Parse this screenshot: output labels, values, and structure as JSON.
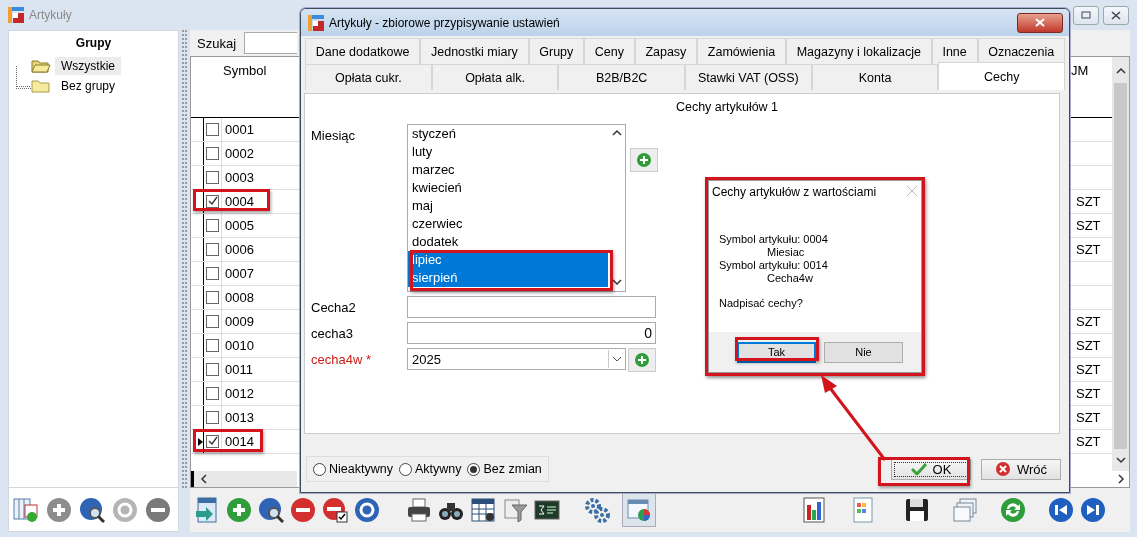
{
  "app_window": {
    "title": "Artykuły"
  },
  "groups_panel": {
    "title": "Grupy",
    "tree": [
      {
        "label": "Wszystkie",
        "selected": true
      },
      {
        "label": "Bez grupy",
        "selected": false
      }
    ]
  },
  "search": {
    "label": "Szukaj"
  },
  "grid": {
    "columns": [
      "Symbol",
      "JM"
    ],
    "rows": [
      {
        "symbol": "0001",
        "checked": false,
        "current": false
      },
      {
        "symbol": "0002",
        "checked": false,
        "current": false
      },
      {
        "symbol": "0003",
        "checked": false,
        "current": false
      },
      {
        "symbol": "0004",
        "unit": "SZT",
        "checked": true,
        "current": false
      },
      {
        "symbol": "0005",
        "unit": "SZT",
        "checked": false,
        "current": false
      },
      {
        "symbol": "0006",
        "unit": "SZT",
        "checked": false,
        "current": false
      },
      {
        "symbol": "0007",
        "checked": false,
        "current": false
      },
      {
        "symbol": "0008",
        "checked": false,
        "current": false
      },
      {
        "symbol": "0009",
        "unit": "SZT",
        "checked": false,
        "current": false
      },
      {
        "symbol": "0010",
        "unit": "SZT",
        "checked": false,
        "current": false
      },
      {
        "symbol": "0011",
        "unit": "SZT",
        "checked": false,
        "current": false
      },
      {
        "symbol": "0012",
        "unit": "SZT",
        "checked": false,
        "current": false
      },
      {
        "symbol": "0013",
        "unit": "SZT",
        "checked": false,
        "current": false
      },
      {
        "symbol": "0014",
        "unit": "SZT",
        "checked": true,
        "current": true
      }
    ]
  },
  "dialog": {
    "title": "Artykuły - zbiorowe przypisywanie ustawień",
    "tab_rows": [
      [
        {
          "label": "Dane dodatkowe",
          "selected": false
        },
        {
          "label": "Jednostki miary",
          "selected": false
        },
        {
          "label": "Grupy",
          "selected": false
        },
        {
          "label": "Ceny",
          "selected": false
        },
        {
          "label": "Zapasy",
          "selected": false
        },
        {
          "label": "Zamówienia",
          "selected": false
        },
        {
          "label": "Magazyny i lokalizacje",
          "selected": false
        },
        {
          "label": "Inne",
          "selected": false
        },
        {
          "label": "Oznaczenia",
          "selected": false
        }
      ],
      [
        {
          "label": "Opłata cukr.",
          "selected": false
        },
        {
          "label": "Opłata alk.",
          "selected": false
        },
        {
          "label": "B2B/B2C",
          "selected": false
        },
        {
          "label": "Stawki VAT (OSS)",
          "selected": false
        },
        {
          "label": "Konta",
          "selected": false
        },
        {
          "label": "Cechy",
          "selected": true
        }
      ]
    ],
    "section_title": "Cechy artykułów 1",
    "fields": [
      {
        "kind": "list",
        "label": "Miesiąc",
        "required": false,
        "options": [
          {
            "label": "styczeń",
            "selected": false
          },
          {
            "label": "luty",
            "selected": false
          },
          {
            "label": "marzec",
            "selected": false
          },
          {
            "label": "kwiecień",
            "selected": false
          },
          {
            "label": "maj",
            "selected": false
          },
          {
            "label": "czerwiec",
            "selected": false
          },
          {
            "label": "dodatek",
            "selected": false
          },
          {
            "label": "lipiec",
            "selected": true
          },
          {
            "label": "sierpień",
            "selected": true
          }
        ]
      },
      {
        "kind": "text",
        "label": "Cecha2",
        "required": false
      },
      {
        "kind": "number",
        "label": "cecha3",
        "required": false,
        "value": "0"
      },
      {
        "kind": "combo",
        "label": "cecha4w *",
        "required": true,
        "value": "2025"
      }
    ],
    "status_options": [
      {
        "label": "Nieaktywny",
        "selected": false
      },
      {
        "label": "Aktywny",
        "selected": false
      },
      {
        "label": "Bez zmian",
        "selected": true
      }
    ],
    "buttons": [
      {
        "kind": "ok",
        "label": "OK"
      },
      {
        "kind": "back",
        "label": "Wróć"
      }
    ]
  },
  "message_box": {
    "title": "Cechy artykułów z wartościami",
    "lines": [
      {
        "kind": "symbol",
        "text": "Symbol artykułu: 0004"
      },
      {
        "kind": "feature",
        "text": "Miesiac"
      },
      {
        "kind": "symbol",
        "text": "Symbol artykułu: 0014"
      },
      {
        "kind": "feature",
        "text": "Cecha4w"
      }
    ],
    "question": "Nadpisać cechy?",
    "buttons": [
      {
        "label": "Tak",
        "selected": true
      },
      {
        "label": "Nie",
        "selected": false
      }
    ]
  }
}
